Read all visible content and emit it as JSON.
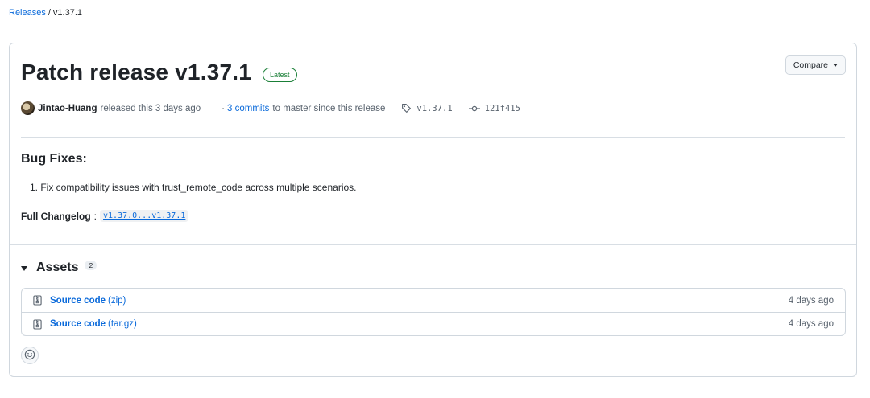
{
  "breadcrumb": {
    "releases_link": "Releases",
    "separator": "/",
    "current": "v1.37.1"
  },
  "release": {
    "title": "Patch release v1.37.1",
    "badge": "Latest",
    "compare_label": "Compare",
    "meta": {
      "author": "Jintao-Huang",
      "released_text": "released this 3 days ago",
      "dot": "·",
      "commits_link": "3 commits",
      "commits_suffix": "to master since this release",
      "tag": "v1.37.1",
      "commit_sha": "121f415"
    },
    "body": {
      "heading": "Bug Fixes:",
      "items": [
        "1. Fix compatibility issues with trust_remote_code across multiple scenarios."
      ],
      "changelog_label": "Full Changelog",
      "changelog_colon": ":",
      "changelog_link": "v1.37.0...v1.37.1"
    }
  },
  "assets": {
    "title": "Assets",
    "count": "2",
    "items": [
      {
        "name": "Source code",
        "ext": "(zip)",
        "date": "4 days ago"
      },
      {
        "name": "Source code",
        "ext": "(tar.gz)",
        "date": "4 days ago"
      }
    ]
  },
  "icons": {
    "tag": "tag-icon",
    "commit": "git-commit-icon",
    "zip": "file-zip-icon",
    "emoji": "smiley-icon",
    "caret": "triangle-down-icon"
  },
  "colors": {
    "link": "#0969da",
    "latest": "#1a7f37",
    "border": "#d0d7de"
  }
}
